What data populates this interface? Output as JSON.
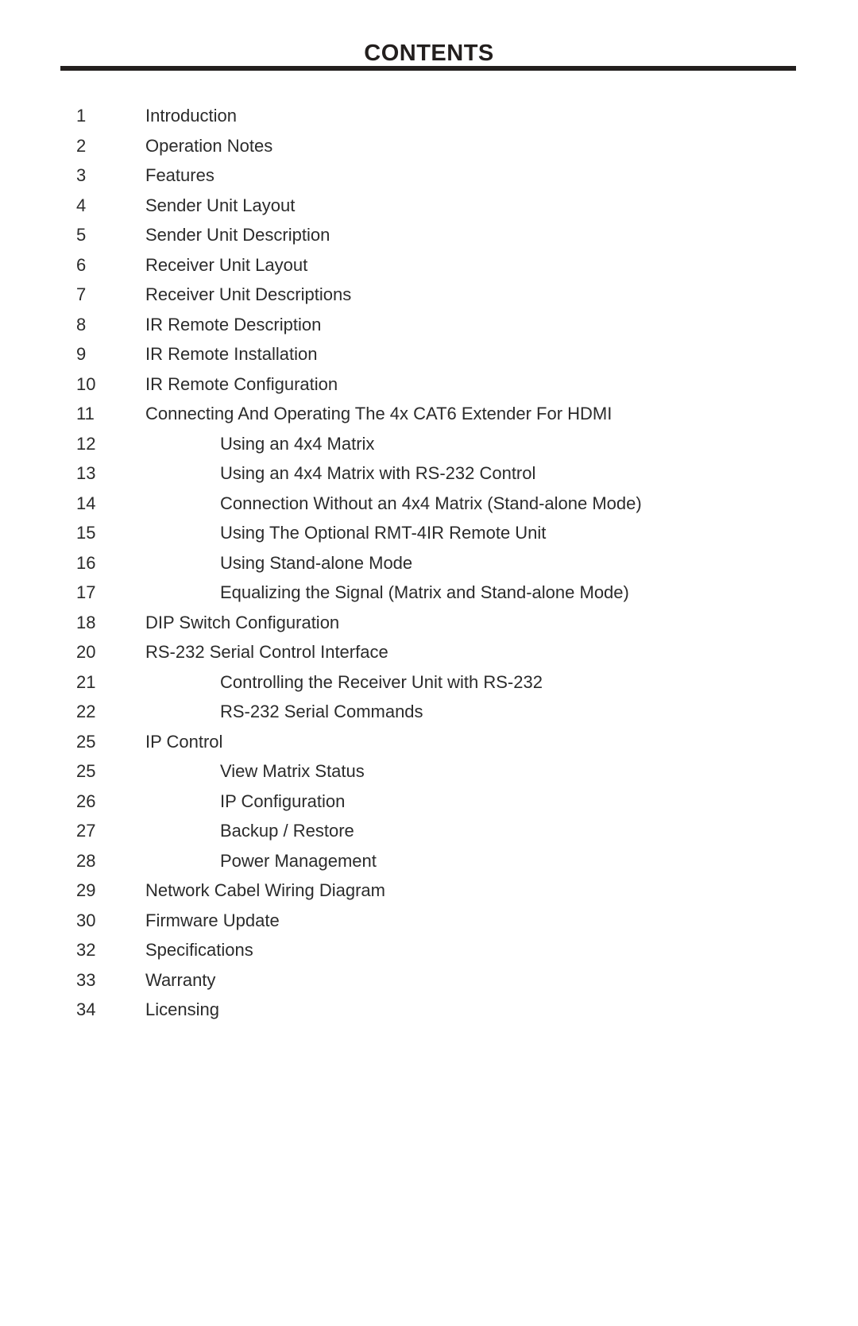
{
  "document": {
    "title": "CONTENTS",
    "colors": {
      "text": "#2b2b2b",
      "rule": "#231f1e",
      "background": "#ffffff"
    }
  },
  "toc": {
    "entries": [
      {
        "page": "1",
        "label": "Introduction",
        "level": 1
      },
      {
        "page": "2",
        "label": "Operation Notes",
        "level": 1
      },
      {
        "page": "3",
        "label": "Features",
        "level": 1
      },
      {
        "page": "4",
        "label": "Sender Unit Layout",
        "level": 1
      },
      {
        "page": "5",
        "label": "Sender Unit Description",
        "level": 1
      },
      {
        "page": "6",
        "label": "Receiver Unit Layout",
        "level": 1
      },
      {
        "page": "7",
        "label": "Receiver Unit Descriptions",
        "level": 1
      },
      {
        "page": "8",
        "label": "IR Remote Description",
        "level": 1
      },
      {
        "page": "9",
        "label": "IR Remote Installation",
        "level": 1
      },
      {
        "page": "10",
        "label": "IR Remote Configuration",
        "level": 1
      },
      {
        "page": "11",
        "label": "Connecting And Operating The 4x CAT6 Extender For HDMI",
        "level": 1
      },
      {
        "page": "12",
        "label": "Using an 4x4 Matrix",
        "level": 2
      },
      {
        "page": "13",
        "label": "Using an 4x4 Matrix with RS-232 Control",
        "level": 2
      },
      {
        "page": "14",
        "label": "Connection Without an 4x4 Matrix (Stand-alone Mode)",
        "level": 2
      },
      {
        "page": "15",
        "label": "Using The Optional RMT-4IR Remote Unit",
        "level": 2
      },
      {
        "page": "16",
        "label": "Using Stand-alone Mode",
        "level": 2
      },
      {
        "page": "17",
        "label": "Equalizing the Signal (Matrix and Stand-alone Mode)",
        "level": 2
      },
      {
        "page": "18",
        "label": "DIP Switch Configuration",
        "level": 1
      },
      {
        "page": "20",
        "label": "RS-232 Serial Control Interface",
        "level": 1
      },
      {
        "page": "21",
        "label": "Controlling the Receiver Unit with RS-232",
        "level": 2
      },
      {
        "page": "22",
        "label": "RS-232 Serial Commands",
        "level": 2
      },
      {
        "page": "25",
        "label": "IP Control",
        "level": 1
      },
      {
        "page": "25",
        "label": "View Matrix Status",
        "level": 2
      },
      {
        "page": "26",
        "label": "IP Configuration",
        "level": 2
      },
      {
        "page": "27",
        "label": "Backup / Restore",
        "level": 2
      },
      {
        "page": "28",
        "label": "Power Management",
        "level": 2
      },
      {
        "page": "29",
        "label": "Network Cabel Wiring Diagram",
        "level": 1
      },
      {
        "page": "30",
        "label": "Firmware Update",
        "level": 1
      },
      {
        "page": "32",
        "label": "Specifications",
        "level": 1
      },
      {
        "page": "33",
        "label": "Warranty",
        "level": 1
      },
      {
        "page": "34",
        "label": "Licensing",
        "level": 1
      }
    ]
  }
}
